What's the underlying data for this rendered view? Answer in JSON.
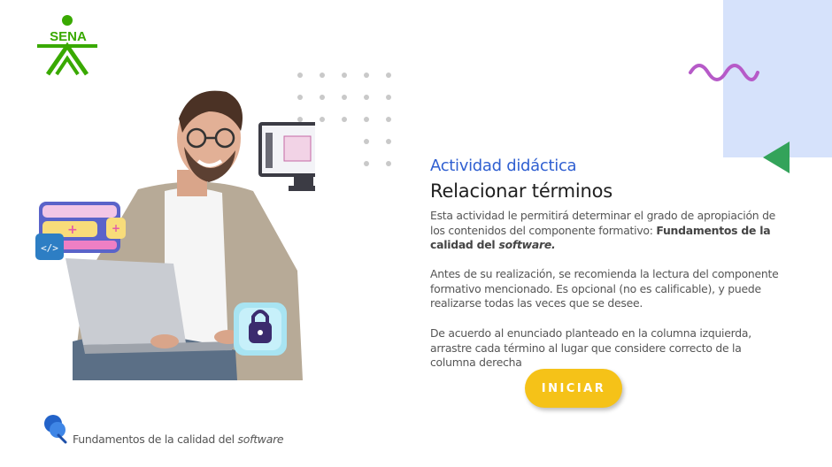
{
  "brand": {
    "logo_text": "SENA",
    "color": "#39a900"
  },
  "accent_colors": {
    "panel": "#d6e2fb",
    "wave": "#b65ac8",
    "triangle": "#33a35a",
    "button": "#f5c218",
    "subtitle": "#2f5fd1"
  },
  "content": {
    "subtitle": "Actividad didáctica",
    "title": "Relacionar términos",
    "p1_text": "Esta actividad le permitirá determinar el grado de apropiación de los contenidos del componente formativo: ",
    "p1_bold": "Fundamentos de la calidad del ",
    "p1_bold_italic": "software.",
    "p2": "Antes de su realización, se recomienda la lectura del componente formativo mencionado.  Es opcional (no es calificable), y puede realizarse todas las veces que se desee.",
    "p3": "De acuerdo al enunciado planteado en la columna izquierda, arrastre cada término al lugar que considere correcto de la columna derecha"
  },
  "start_button": {
    "label": "INICIAR"
  },
  "footer": {
    "text": "Fundamentos de la calidad del ",
    "italic": "software"
  },
  "icons": [
    "sena-logo",
    "code-icon",
    "lock-icon",
    "monitor-icon",
    "pin-icon",
    "wave-decoration",
    "triangle-decoration"
  ]
}
